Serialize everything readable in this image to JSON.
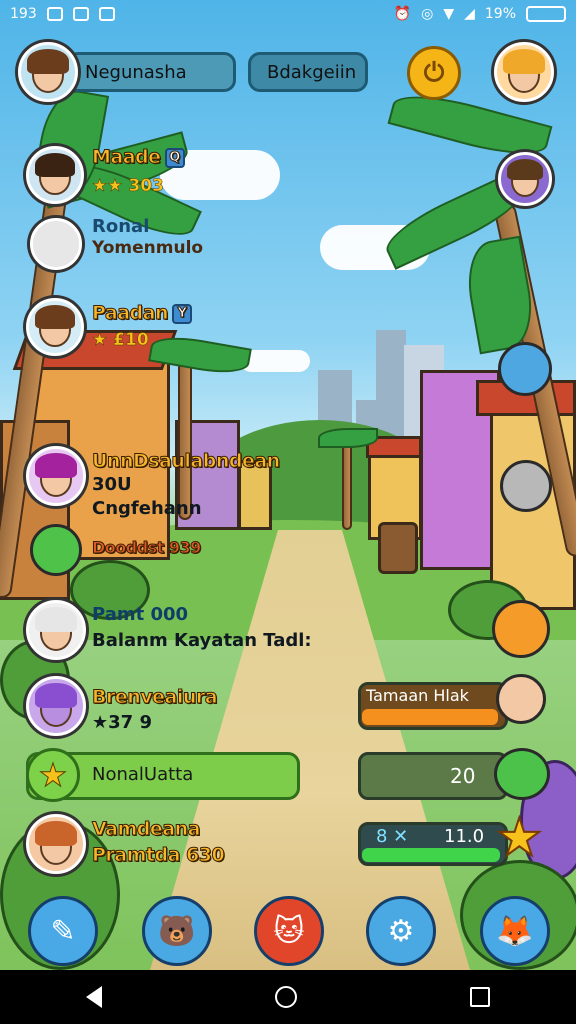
{
  "status_bar": {
    "time": "193",
    "battery": "19%",
    "left_icons": [
      "settings-icon",
      "phone-icon",
      "image-icon"
    ],
    "right_icons": [
      "alarm-icon",
      "location-icon",
      "wifi-icon",
      "signal-icon",
      "battery-icon"
    ]
  },
  "top_bar": {
    "tab_left": "Negunasha",
    "tab_right": "Bdakgeiin",
    "power_icon": "power-icon"
  },
  "players": [
    {
      "name": "Maade",
      "sub": "★★ 303",
      "badge": "Q"
    },
    {
      "name": "Ronal",
      "sub": "Yomenmulo"
    },
    {
      "name": "Paadan",
      "sub": "★ £10",
      "badge": "Y"
    },
    {
      "name": "UnnDsaulabndean",
      "sub": "30U",
      "sub2": "Cngfehann"
    },
    {
      "name": "Dooddst 939",
      "sub": ""
    },
    {
      "name": "Pamt 000",
      "sub": "Balanm Kayatan Tadl:"
    },
    {
      "name": "Brenveaiura",
      "sub": "★37 9"
    },
    {
      "name": "Vamdeana",
      "sub": "Pramtda 630"
    }
  ],
  "green_bar": {
    "label": "NonalUatta"
  },
  "right_panels": {
    "task_label": "Tamaan Hlak",
    "task_progress": 0.78,
    "count_value": "20",
    "energy_label": "8 ✕",
    "energy_value": "11.0",
    "energy_progress": 0.92
  },
  "action_buttons": [
    {
      "name": "quill-icon",
      "glyph": "✎",
      "color": "#49a9e6"
    },
    {
      "name": "bear-icon",
      "glyph": "🐻",
      "color": "#4aa8e2"
    },
    {
      "name": "cat-icon",
      "glyph": "🐱",
      "color": "#e2462a"
    },
    {
      "name": "gear-icon",
      "glyph": "⚙",
      "color": "#4aa8e2"
    },
    {
      "name": "fox-icon",
      "glyph": "🦊",
      "color": "#49a9e6"
    }
  ],
  "colors": {
    "accent": "#f6b517",
    "name_gold": "#f8b62b",
    "green": "#7dcc4a"
  }
}
